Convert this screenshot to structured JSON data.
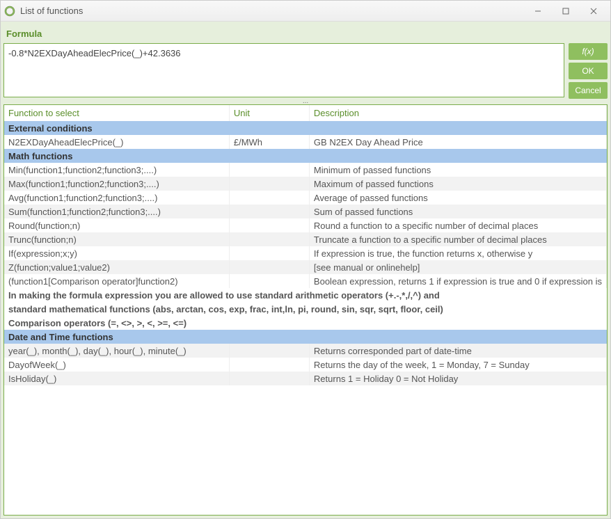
{
  "titlebar": {
    "title": "List of functions"
  },
  "labels": {
    "formula": "Formula",
    "fx": "f(x)",
    "ok": "OK",
    "cancel": "Cancel",
    "splitter": "...",
    "col_function": "Function to select",
    "col_unit": "Unit",
    "col_description": "Description"
  },
  "formula_value": "-0.8*N2EXDayAheadElecPrice(_)+42.3636",
  "sections": [
    {
      "title": "External conditions",
      "rows": [
        {
          "func": "N2EXDayAheadElecPrice(_)",
          "unit": "£/MWh",
          "desc": "GB N2EX Day Ahead Price"
        }
      ]
    },
    {
      "title": "Math functions",
      "rows": [
        {
          "func": "Min(function1;function2;function3;....)",
          "unit": "",
          "desc": "Minimum of passed functions"
        },
        {
          "func": "Max(function1;function2;function3;....)",
          "unit": "",
          "desc": "Maximum of passed functions"
        },
        {
          "func": "Avg(function1;function2;function3;....)",
          "unit": "",
          "desc": "Average of passed functions"
        },
        {
          "func": "Sum(function1;function2;function3;....)",
          "unit": "",
          "desc": "Sum of passed functions"
        },
        {
          "func": "Round(function;n)",
          "unit": "",
          "desc": "Round a function to a specific number of decimal places"
        },
        {
          "func": "Trunc(function;n)",
          "unit": "",
          "desc": "Truncate a function to a specific number of decimal places"
        },
        {
          "func": "If(expression;x;y)",
          "unit": "",
          "desc": "If expression is true, the function returns x, otherwise y"
        },
        {
          "func": "Z(function;value1;value2)",
          "unit": "",
          "desc": "[see manual or onlinehelp]"
        },
        {
          "func": "(function1[Comparison operator]function2)",
          "unit": "",
          "desc": "Boolean expression, returns 1 if expression is true and 0 if expression is"
        }
      ],
      "notes": [
        "In making the formula expression you are allowed to use standard arithmetic operators (+.-,*,/,^) and",
        "standard mathematical functions (abs, arctan, cos, exp, frac, int,ln, pi, round, sin, sqr, sqrt, floor, ceil)",
        "Comparison operators (=, <>, >, <, >=, <=)"
      ]
    },
    {
      "title": "Date and Time functions",
      "rows": [
        {
          "func": "year(_), month(_), day(_), hour(_), minute(_)",
          "unit": "",
          "desc": "Returns corresponded part of date-time"
        },
        {
          "func": "DayofWeek(_)",
          "unit": "",
          "desc": "Returns the day of the week, 1 = Monday, 7 = Sunday"
        },
        {
          "func": "IsHoliday(_)",
          "unit": "",
          "desc": "Returns 1 = Holiday 0 = Not Holiday"
        }
      ]
    }
  ]
}
